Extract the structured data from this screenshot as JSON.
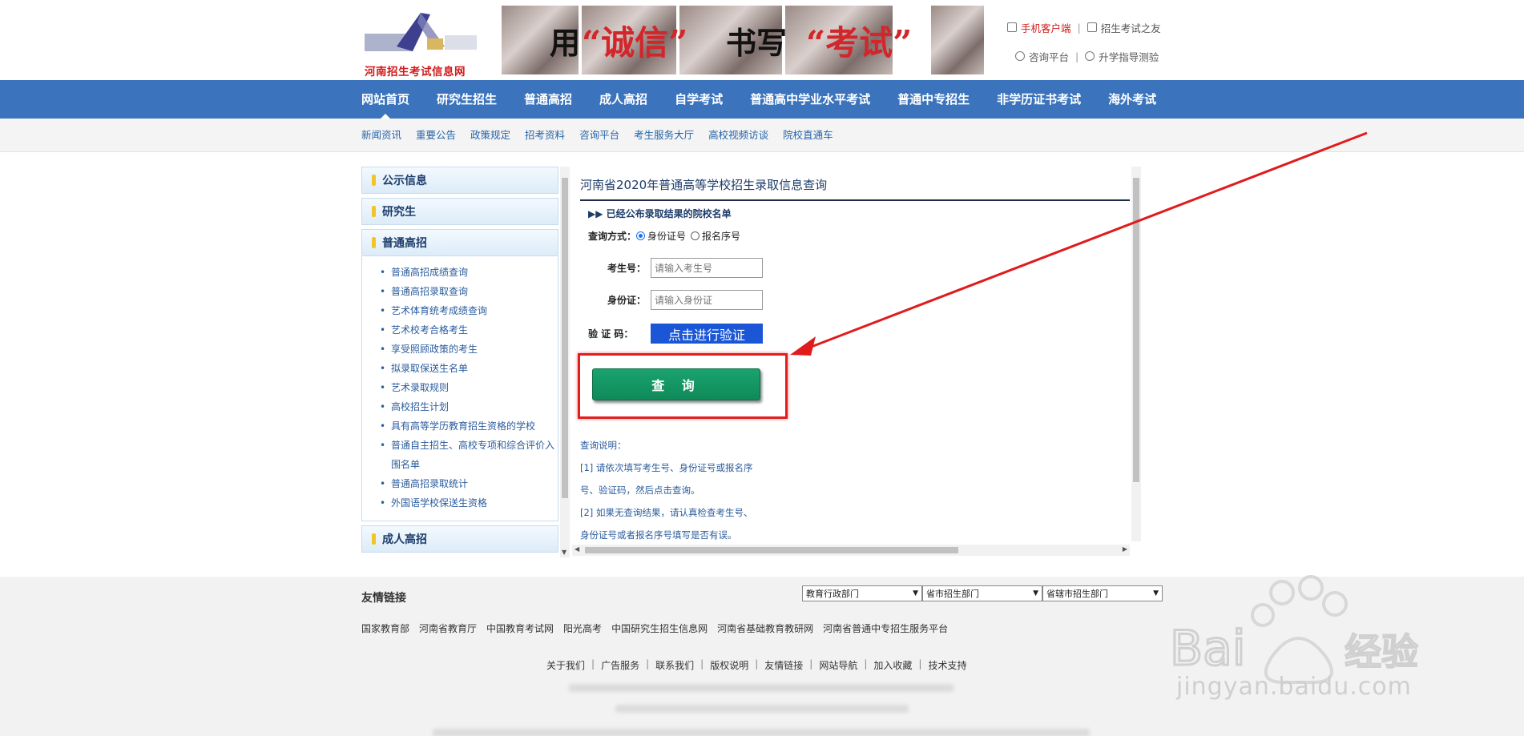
{
  "header": {
    "logo_text": "河南招生考试信息网",
    "banner": {
      "w1": "用",
      "q1": "“诚信”",
      "w2": "书写",
      "q2": "“考试”"
    },
    "toplinks": {
      "mobile": "手机客户端",
      "friend": "招生考试之友",
      "consult": "咨询平台",
      "guide": "升学指导测验"
    }
  },
  "nav": {
    "items": [
      "网站首页",
      "研究生招生",
      "普通高招",
      "成人高招",
      "自学考试",
      "普通高中学业水平考试",
      "普通中专招生",
      "非学历证书考试",
      "海外考试"
    ]
  },
  "subnav": {
    "items": [
      "新闻资讯",
      "重要公告",
      "政策规定",
      "招考资料",
      "咨询平台",
      "考生服务大厅",
      "高校视频访谈",
      "院校直通车"
    ]
  },
  "sidebar": {
    "sections": [
      "公示信息",
      "研究生",
      "普通高招",
      "成人高招"
    ],
    "gaokao_items": [
      "普通高招成绩查询",
      "普通高招录取查询",
      "艺术体育统考成绩查询",
      "艺术校考合格考生",
      "享受照顾政策的考生",
      "拟录取保送生名单",
      "艺术录取规则",
      "高校招生计划",
      "具有高等学历教育招生资格的学校",
      "普通自主招生、高校专项和综合评价入围名单",
      "普通高招录取统计",
      "外国语学校保送生资格"
    ]
  },
  "panel": {
    "title": "河南省2020年普通高等学校招生录取信息查询",
    "announce": "▶▶ 已经公布录取结果的院校名单",
    "mode_label": "查询方式：",
    "mode_id": "身份证号",
    "mode_reg": "报名序号",
    "exam_label": "考生号：",
    "exam_placeholder": "请输入考生号",
    "id_label": "身份证：",
    "id_placeholder": "请输入身份证",
    "captcha_label": "验 证 码：",
    "captcha_button": "点击进行验证",
    "query_button": "查 询",
    "notes": [
      "查询说明：",
      "[1] 请依次填写考生号、身份证号或报名序",
      "号、验证码，然后点击查询。",
      "[2] 如果无查询结果，请认真检查考生号、",
      "身份证号或者报名序号填写是否有误。"
    ]
  },
  "footer": {
    "friend_title": "友情链接",
    "selects": [
      "教育行政部门",
      "省市招生部门",
      "省辖市招生部门"
    ],
    "friend_links": [
      "国家教育部",
      "河南省教育厅",
      "中国教育考试网",
      "阳光高考",
      "中国研究生招生信息网",
      "河南省基础教育教研网",
      "河南省普通中专招生服务平台"
    ],
    "bottom_links": [
      "关于我们",
      "广告服务",
      "联系我们",
      "版权说明",
      "友情链接",
      "网站导航",
      "加入收藏",
      "技术支持"
    ]
  },
  "watermark": {
    "text": "jingyan.baidu.com",
    "brand": "Bai",
    "brand_suffix": "经验"
  },
  "colors": {
    "nav": "#3b74bd",
    "query": "#0f8a58",
    "highlight": "#e11d1d",
    "verify": "#1a56d6"
  }
}
